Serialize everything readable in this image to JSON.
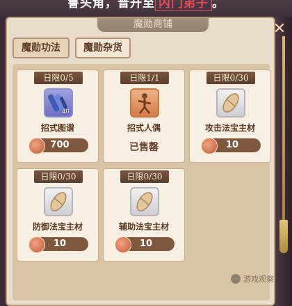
{
  "banner": {
    "prefix": "鲁头角，晋升至",
    "highlight": "内门弟子",
    "suffix": "。"
  },
  "panel_title": "魔勋商铺",
  "tabs": [
    {
      "label": "魔勋功法"
    },
    {
      "label": "魔勋杂货"
    }
  ],
  "items": [
    {
      "limit": "日限0/5",
      "name": "招式图谱",
      "qty": "40",
      "price": "700",
      "sold": ""
    },
    {
      "limit": "日限1/1",
      "name": "招式人偶",
      "qty": "",
      "price": "",
      "sold": "已售罄"
    },
    {
      "limit": "日限0/30",
      "name": "攻击法宝主材",
      "qty": "",
      "price": "10",
      "sold": ""
    },
    {
      "limit": "日限0/30",
      "name": "防御法宝主材",
      "qty": "",
      "price": "10",
      "sold": ""
    },
    {
      "limit": "日限0/30",
      "name": "辅助法宝主材",
      "qty": "",
      "price": "10",
      "sold": ""
    }
  ],
  "icons": {
    "close": "close-icon",
    "currency": "coin-icon",
    "item_scroll": "scroll-icon",
    "item_puppet": "puppet-icon",
    "item_material": "jade-material-icon"
  },
  "colors": {
    "panel_bg": "#e9dcc8",
    "limit_tag": "#7a5640",
    "price_bar": "#7e573f",
    "highlight_red": "#e8475a",
    "highlight_gold": "#ffd96a"
  },
  "watermark": "游戏观察"
}
